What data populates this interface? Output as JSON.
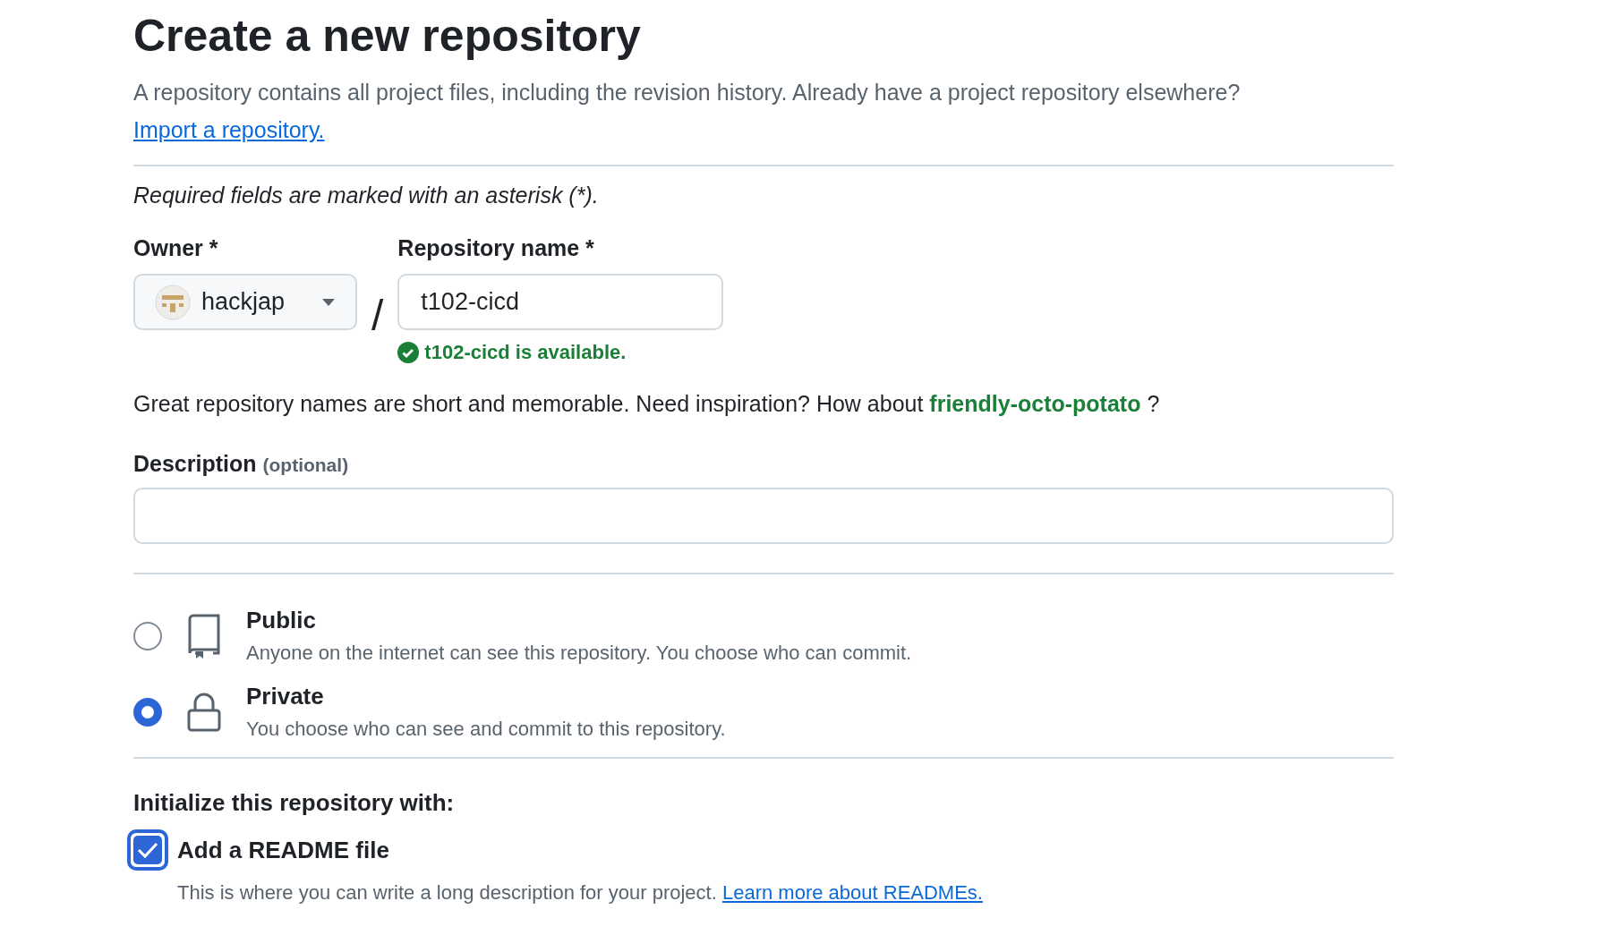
{
  "title": "Create a new repository",
  "intro": {
    "text": "A repository contains all project files, including the revision history. Already have a project repository elsewhere?",
    "link": "Import a repository."
  },
  "required_note": "Required fields are marked with an asterisk (*).",
  "owner": {
    "label": "Owner *",
    "value": "hackjap"
  },
  "separator": "/",
  "repo_name": {
    "label": "Repository name *",
    "value": "t102-cicd",
    "status": "t102-cicd is available."
  },
  "hint": {
    "before": "Great repository names are short and memorable. Need inspiration? How about",
    "suggestion": "friendly-octo-potato",
    "after": "?"
  },
  "description": {
    "label": "Description",
    "note": "(optional)"
  },
  "visibility": [
    {
      "kind": "book",
      "title": "Public",
      "text": "Anyone on the internet can see this repository. You choose who can commit.",
      "selected": false
    },
    {
      "kind": "lock",
      "title": "Private",
      "text": "You choose who can see and commit to this repository.",
      "selected": true
    }
  ],
  "init": {
    "heading": "Initialize this repository with:",
    "readme": {
      "label": "Add a README file",
      "checked": true,
      "text": "This is where you can write a long description for your project.",
      "link": "Learn more about READMEs."
    }
  }
}
